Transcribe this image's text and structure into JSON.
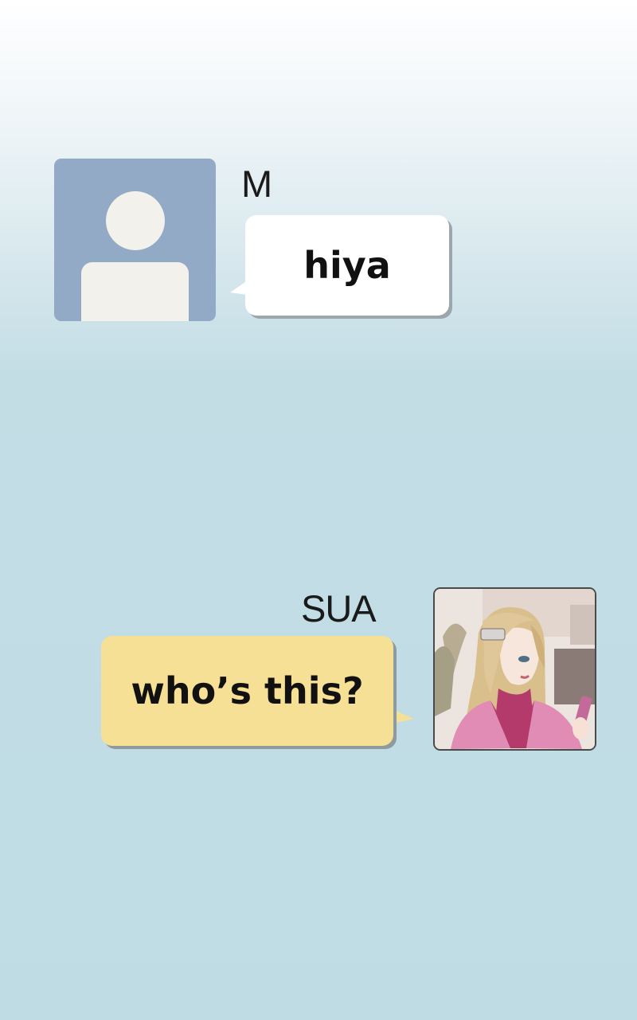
{
  "messages": [
    {
      "sender": "M",
      "text": "hiya",
      "side": "left",
      "bubble_color": "#ffffff",
      "avatar": "default-person-icon"
    },
    {
      "sender": "SUA",
      "text": "who’s this?",
      "side": "right",
      "bubble_color": "#f6e096",
      "avatar": "profile-photo-illustration"
    }
  ],
  "colors": {
    "default_avatar_bg": "#93aac6",
    "background": "#bfdce4"
  }
}
